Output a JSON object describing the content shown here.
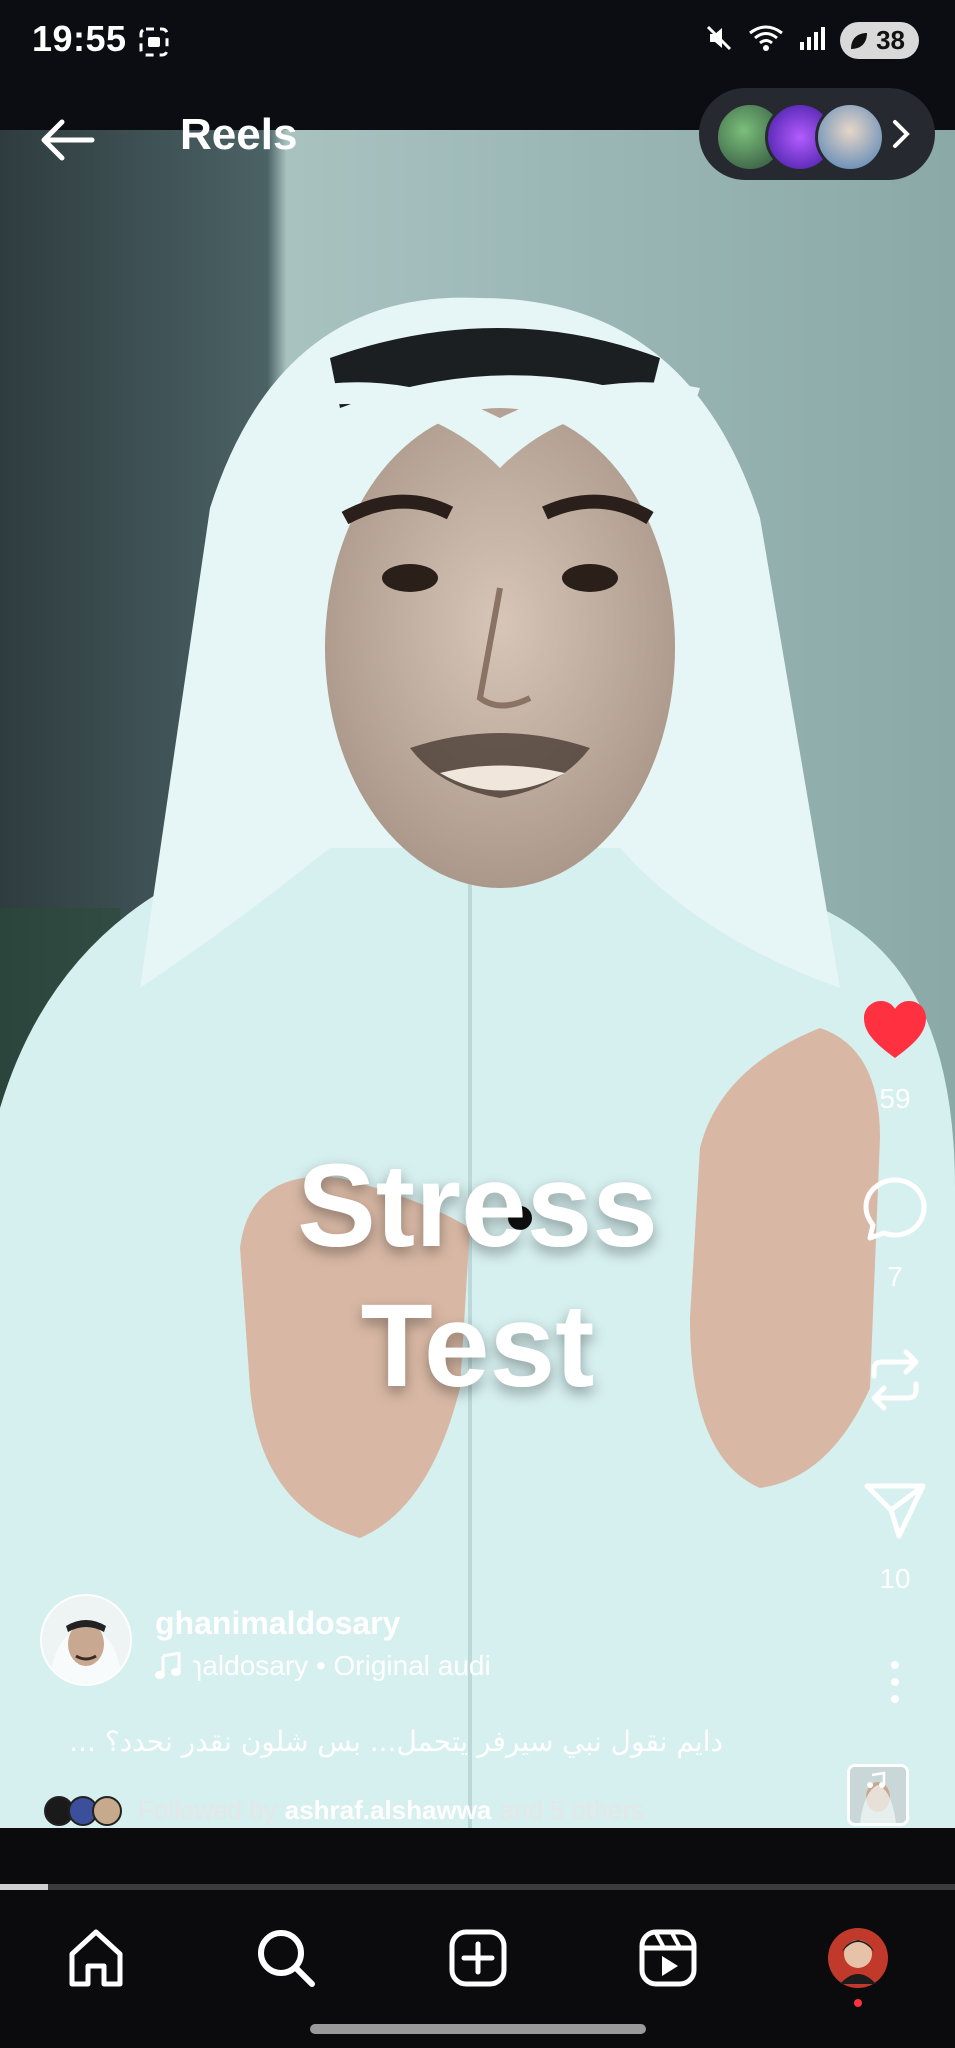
{
  "status_bar": {
    "time": "19:55",
    "battery": "38"
  },
  "header": {
    "title": "Reels"
  },
  "reel": {
    "overlay_text_line1": "Stress",
    "overlay_text_line2": "Test",
    "likes": "59",
    "comments": "7",
    "shares": "10",
    "username": "ghanimaldosary",
    "audio": "ɿaldosary • Original audi",
    "description": "دايم نقول نبي سيرفر يتحمل... بس شلون نقدر نحدد؟ ...",
    "followed_prefix": "Followed by",
    "followed_user": "ashraf.alshawwa",
    "followed_suffix": "and 5 others",
    "progress_fraction": 0.05
  },
  "icons": {
    "back": "back-arrow-icon",
    "like": "heart-icon",
    "comment": "comment-icon",
    "repost": "repost-icon",
    "share": "send-icon",
    "more": "more-icon",
    "home": "home-icon",
    "search": "search-icon",
    "create": "create-icon",
    "reels": "reels-icon"
  },
  "colors": {
    "like_red": "#ff3040",
    "background": "#0b0b0d"
  }
}
